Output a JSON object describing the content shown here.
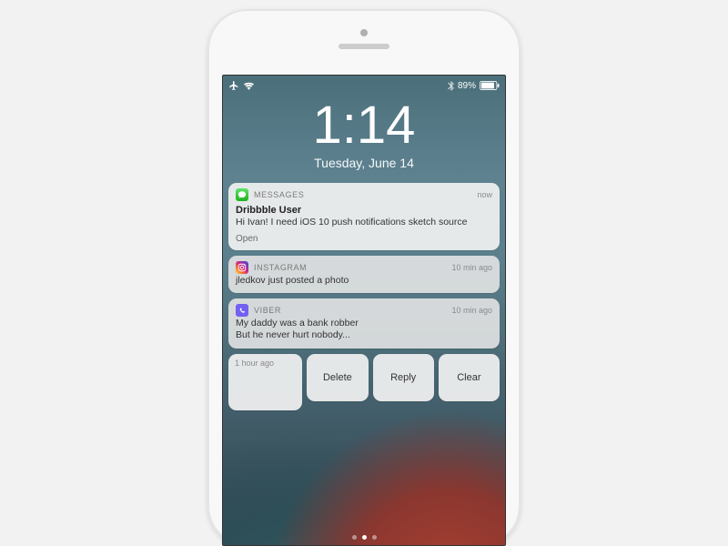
{
  "status_bar": {
    "battery_text": "89%"
  },
  "lock_screen": {
    "time": "1:14",
    "date": "Tuesday, June 14"
  },
  "notifications": [
    {
      "app": "MESSAGES",
      "time": "now",
      "title": "Dribbble User",
      "body": "Hi Ivan! I need iOS 10 push notifications sketch source",
      "action_hint": "Open",
      "icon": "messages-icon",
      "icon_color": "#34C759"
    },
    {
      "app": "INSTAGRAM",
      "time": "10 min ago",
      "title": "",
      "body": "jledkov just posted a photo",
      "action_hint": "",
      "icon": "instagram-icon",
      "icon_color": "#E1306C"
    },
    {
      "app": "VIBER",
      "time": "10 min ago",
      "title": "",
      "body": "My daddy was a bank robber\nBut he never hurt nobody...",
      "action_hint": "",
      "icon": "viber-icon",
      "icon_color": "#7360F2"
    }
  ],
  "action_row": {
    "time_label": "1 hour ago",
    "buttons": [
      "Delete",
      "Reply",
      "Clear"
    ]
  }
}
